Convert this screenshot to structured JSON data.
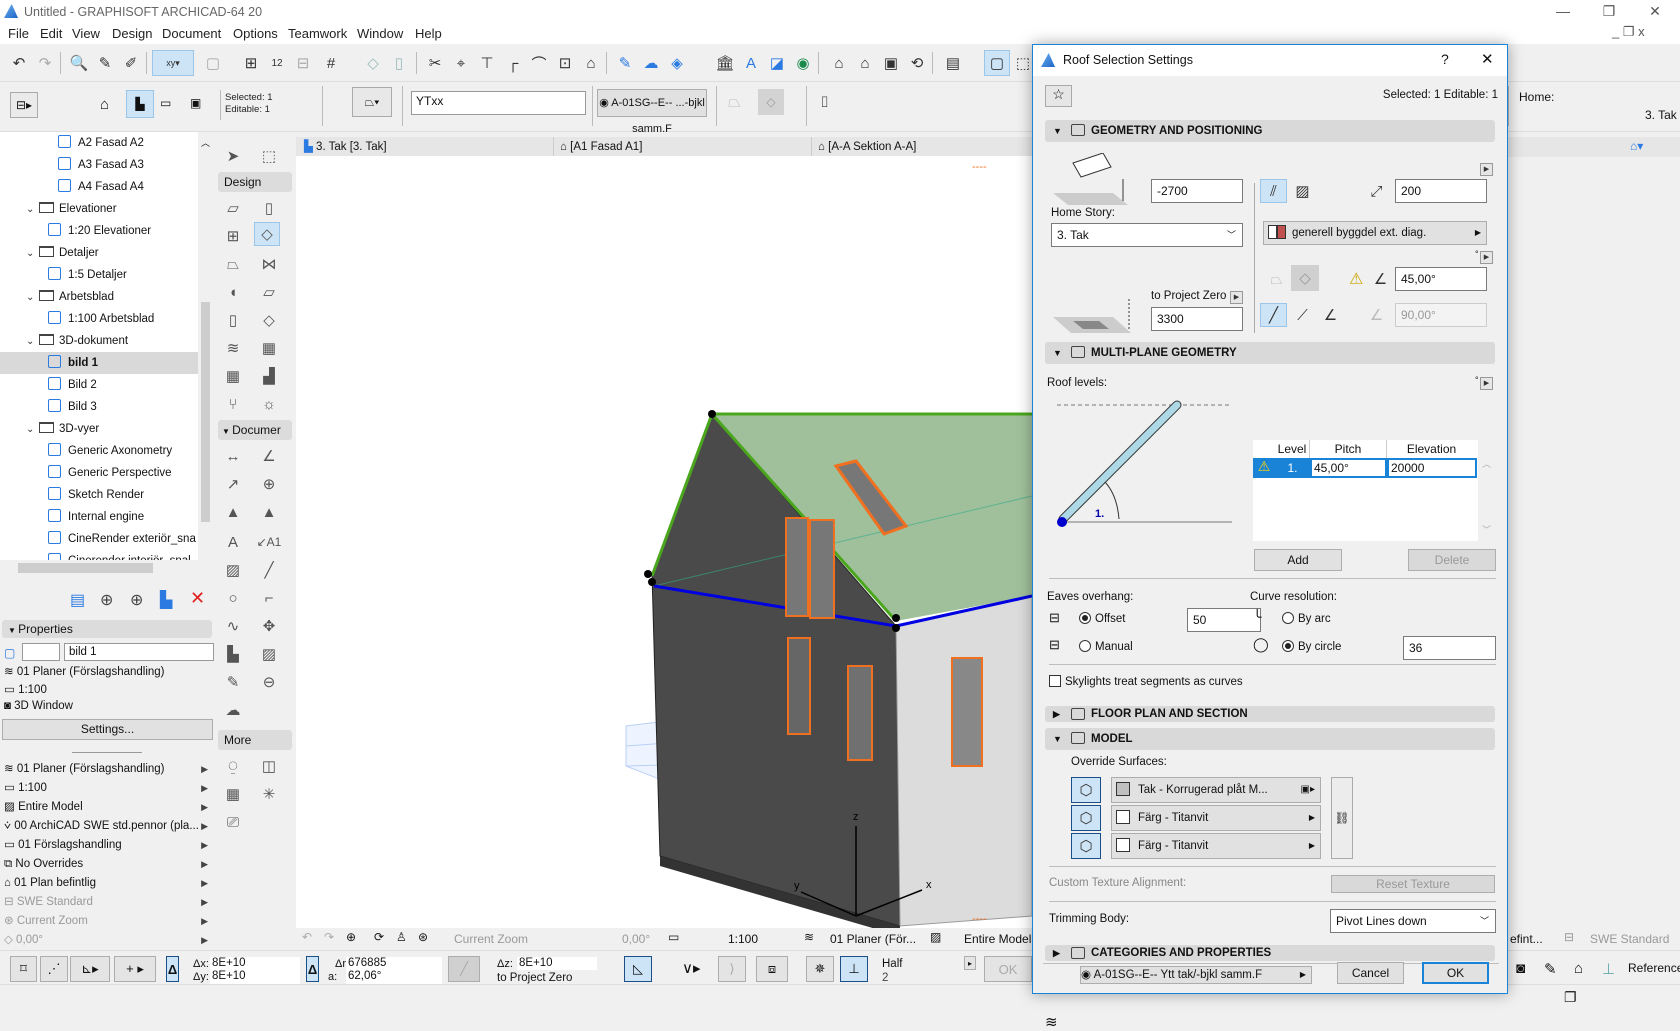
{
  "window": {
    "title": "Untitled - GRAPHISOFT ARCHICAD-64 20"
  },
  "menu": [
    "File",
    "Edit",
    "View",
    "Design",
    "Document",
    "Options",
    "Teamwork",
    "Window",
    "Help"
  ],
  "infobox": {
    "selected": "Selected: 1",
    "editable": "Editable: 1",
    "id_value": "YTxx",
    "layer": "A-01SG--E-- ...-bjkl samm.F",
    "home_label": "Home:",
    "home_value": "3. Tak"
  },
  "tabs": [
    {
      "label": "3. Tak [3. Tak]",
      "icon": "floor-plan-icon"
    },
    {
      "label": "[A1 Fasad A1]",
      "icon": "elevation-icon"
    },
    {
      "label": "[A-A Sektion A-A]",
      "icon": "section-icon"
    }
  ],
  "navigator": {
    "items": [
      {
        "label": "A2 Fasad A2",
        "level": 3,
        "type": "view"
      },
      {
        "label": "A3 Fasad A3",
        "level": 3,
        "type": "view"
      },
      {
        "label": "A4 Fasad A4",
        "level": 3,
        "type": "view"
      },
      {
        "label": "Elevationer",
        "level": 1,
        "type": "folder"
      },
      {
        "label": "1:20 Elevationer",
        "level": 2,
        "type": "view"
      },
      {
        "label": "Detaljer",
        "level": 1,
        "type": "folder"
      },
      {
        "label": "1:5 Detaljer",
        "level": 2,
        "type": "view"
      },
      {
        "label": "Arbetsblad",
        "level": 1,
        "type": "folder"
      },
      {
        "label": "1:100 Arbetsblad",
        "level": 2,
        "type": "view"
      },
      {
        "label": "3D-dokument",
        "level": 1,
        "type": "folder"
      },
      {
        "label": "bild 1",
        "level": 2,
        "type": "view",
        "selected": true
      },
      {
        "label": "Bild 2",
        "level": 2,
        "type": "view"
      },
      {
        "label": "Bild 3",
        "level": 2,
        "type": "view"
      },
      {
        "label": "3D-vyer",
        "level": 1,
        "type": "folder"
      },
      {
        "label": "Generic Axonometry",
        "level": 2,
        "type": "view"
      },
      {
        "label": "Generic Perspective",
        "level": 2,
        "type": "view"
      },
      {
        "label": "Sketch Render",
        "level": 2,
        "type": "view"
      },
      {
        "label": "Internal engine",
        "level": 2,
        "type": "view"
      },
      {
        "label": "CineRender exteriör_sna",
        "level": 2,
        "type": "view"
      },
      {
        "label": "Cinerender interiör_snal",
        "level": 2,
        "type": "view"
      }
    ]
  },
  "properties": {
    "header": "Properties",
    "id_value": "",
    "name_value": "bild 1",
    "layer_combo": "01 Planer (Förslagshandling)",
    "scale": "1:100",
    "view_type": "3D Window",
    "settings_button": "Settings..."
  },
  "view_settings": [
    {
      "label": "01 Planer (Förslagshandling)",
      "icon": "layers-icon",
      "enabled": true
    },
    {
      "label": "1:100",
      "icon": "scale-icon",
      "enabled": true
    },
    {
      "label": "Entire Model",
      "icon": "structure-icon",
      "enabled": true
    },
    {
      "label": "00 ArchiCAD SWE std.pennor (pla...",
      "icon": "pen-set-icon",
      "enabled": true
    },
    {
      "label": "01 Förslagshandling",
      "icon": "model-view-icon",
      "enabled": true
    },
    {
      "label": "No Overrides",
      "icon": "overrides-icon",
      "enabled": true
    },
    {
      "label": "01 Plan befintlig",
      "icon": "renovation-icon",
      "enabled": true
    },
    {
      "label": "SWE Standard",
      "icon": "dimension-icon",
      "enabled": false
    },
    {
      "label": "Current Zoom",
      "icon": "zoom-icon",
      "enabled": false
    },
    {
      "label": "0,00°",
      "icon": "rotation-icon",
      "enabled": false
    }
  ],
  "toolbox": {
    "design_label": "Design",
    "document_label": "Documer",
    "more_label": "More"
  },
  "status": {
    "zoom": "Current Zoom",
    "angle": "0,00°",
    "scale": "1:100",
    "layers": "01 Planer (För...",
    "structure": "Entire Model",
    "renovation": "efint...",
    "dimension": "SWE Standard"
  },
  "coords": {
    "dx": "8E+10",
    "dy": "8E+10",
    "dr": "676885",
    "da": "62,06°",
    "dz": "8E+10",
    "z_ref": "to Project Zero",
    "snap_label": "Half",
    "snap_value": "2",
    "ok": "OK",
    "reference": "Reference"
  },
  "dialog": {
    "title": "Roof Selection Settings",
    "help": "?",
    "selected_info": "Selected: 1 Editable: 1",
    "geometry": {
      "header": "GEOMETRY AND POSITIONING",
      "offset": "-2700",
      "home_story_label": "Home Story:",
      "home_story": "3. Tak",
      "to_project_zero_label": "to Project Zero",
      "elevation": "3300",
      "thickness": "200",
      "building_material": "generell byggdel ext. diag.",
      "pitch": "45,00°",
      "edge_angle": "90,00°"
    },
    "multiplane": {
      "header": "MULTI-PLANE GEOMETRY",
      "roof_levels_label": "Roof levels:",
      "diagram_label": "1.",
      "columns": [
        "Level",
        "Pitch",
        "Elevation"
      ],
      "rows": [
        {
          "level": "1.",
          "pitch": "45,00°",
          "elevation": "20000",
          "warning": true
        }
      ],
      "add": "Add",
      "delete": "Delete",
      "eaves_label": "Eaves overhang:",
      "offset_option": "Offset",
      "manual_option": "Manual",
      "eaves_value": "50",
      "eaves_selected": "Offset",
      "curve_label": "Curve resolution:",
      "by_arc": "By arc",
      "by_circle": "By circle",
      "curve_selected": "By circle",
      "curve_value": "36",
      "skylights_label": "Skylights treat segments as curves",
      "skylights_checked": false
    },
    "floor_plan": {
      "header": "FLOOR PLAN AND SECTION"
    },
    "model": {
      "header": "MODEL",
      "override_label": "Override Surfaces:",
      "surfaces": [
        {
          "label": "Tak - Korrugerad plåt M...",
          "color": "#c0c0c0"
        },
        {
          "label": "Färg - Titanvit",
          "color": "#ffffff"
        },
        {
          "label": "Färg - Titanvit",
          "color": "#ffffff"
        }
      ],
      "custom_texture_label": "Custom Texture Alignment:",
      "reset_texture": "Reset Texture",
      "trimming_label": "Trimming Body:",
      "trimming_value": "Pivot Lines down"
    },
    "categories": {
      "header": "CATEGORIES AND PROPERTIES"
    },
    "layer": "A-01SG--E-- Ytt tak/-bjkl samm.F",
    "cancel": "Cancel",
    "ok": "OK"
  },
  "colors": {
    "accent": "#1883d7",
    "selection": "#cde4f7",
    "warning": "#ffd400",
    "material": "#c0504d"
  }
}
